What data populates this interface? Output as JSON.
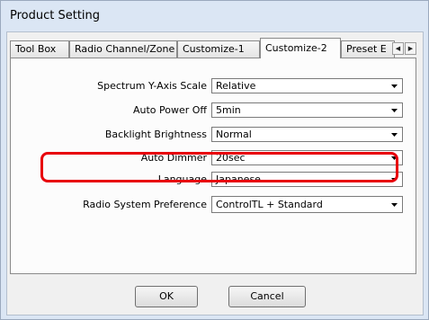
{
  "window": {
    "title": "Product Setting"
  },
  "tabs": [
    {
      "label": "Tool Box",
      "active": false
    },
    {
      "label": "Radio Channel/Zone",
      "active": false
    },
    {
      "label": "Customize-1",
      "active": false
    },
    {
      "label": "Customize-2",
      "active": true
    },
    {
      "label": "Preset E",
      "active": false
    }
  ],
  "tab_scroll": {
    "left": "◀",
    "right": "▶"
  },
  "settings": [
    {
      "label": "Spectrum Y-Axis Scale",
      "value": "Relative"
    },
    {
      "label": "Auto Power Off",
      "value": "5min"
    },
    {
      "label": "Backlight Brightness",
      "value": "Normal"
    },
    {
      "label": "Auto Dimmer",
      "value": "20sec"
    },
    {
      "label": "Language",
      "value": "Japanese"
    },
    {
      "label": "Radio System Preference",
      "value": "ControlTL + Standard"
    }
  ],
  "buttons": {
    "ok": "OK",
    "cancel": "Cancel"
  },
  "colors": {
    "highlight": "#e8000b",
    "window_frame": "#dbe6f4",
    "panel": "#fcfcfc"
  }
}
